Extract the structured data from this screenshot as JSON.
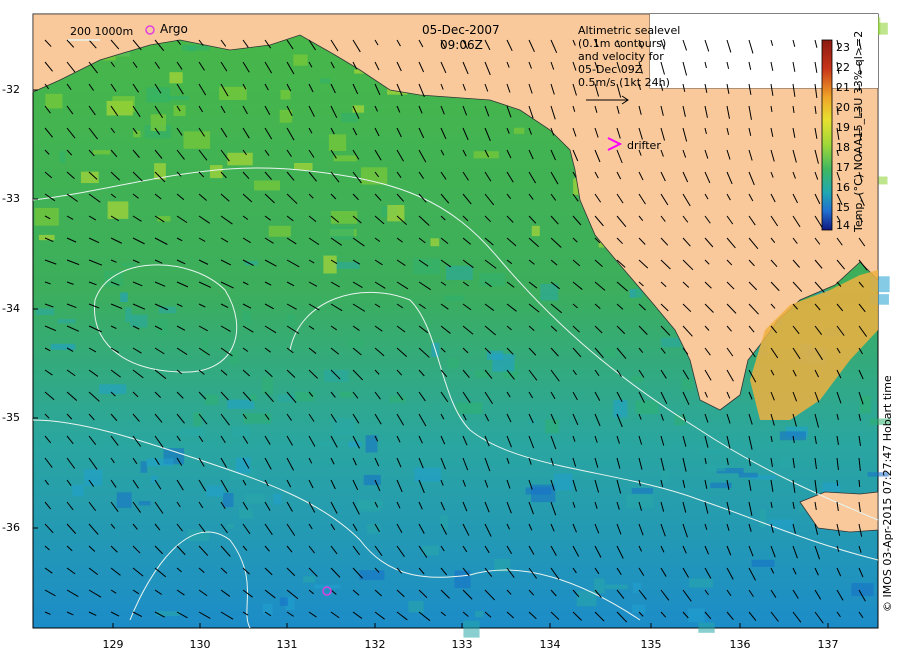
{
  "header": {
    "date": "05-Dec-2007",
    "time": "09:06Z"
  },
  "legend": {
    "depth_scale": "200  1000m",
    "argo_label": "Argo",
    "drifter_label": "drifter",
    "altimetry_lines": [
      "Altimetric sealevel",
      "(0.1m contours)",
      "and velocity for",
      "05-Dec 09Z",
      "0.5m/s (1kt 24h)"
    ]
  },
  "colorbar": {
    "title": "Temp. (°C) NOAA15_L3U 33% ql>=2",
    "ticks": [
      "23",
      "22",
      "21",
      "20",
      "19",
      "18",
      "17",
      "16",
      "15",
      "14"
    ],
    "colors": [
      "#8b1a10",
      "#c8341a",
      "#e0641e",
      "#f0a428",
      "#e8e030",
      "#a0d838",
      "#40b860",
      "#20a8b0",
      "#2070d0",
      "#101880"
    ]
  },
  "axes": {
    "lat_ticks": [
      "-32",
      "-33",
      "-34",
      "-35",
      "-36"
    ],
    "lon_ticks": [
      "129",
      "130",
      "131",
      "132",
      "133",
      "134",
      "135",
      "136",
      "137"
    ]
  },
  "credit": "© IMOS 03-Apr-2015 07:27:47 Hobart time",
  "colors": {
    "land": "#f9c99b",
    "argo": "#e040e0",
    "drifter": "#ff00ff",
    "contour": "#e8f4f0"
  }
}
